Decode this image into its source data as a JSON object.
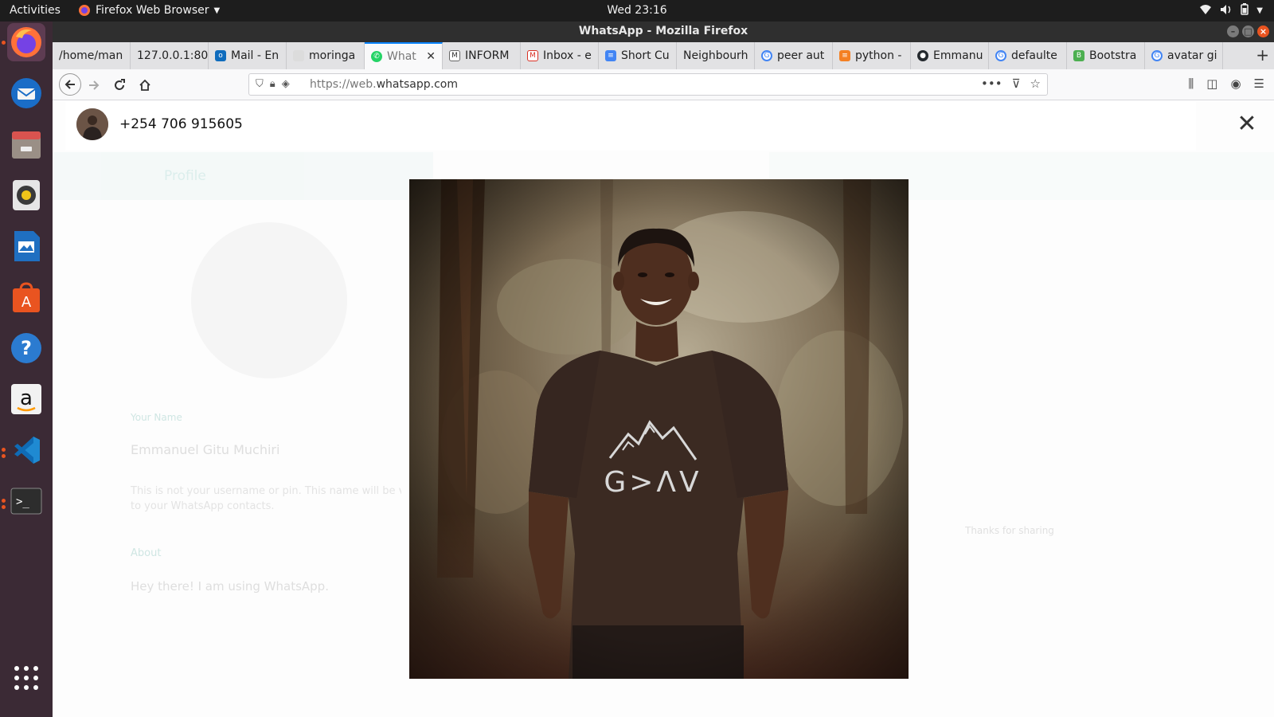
{
  "topbar": {
    "activities": "Activities",
    "app_name": "Firefox Web Browser",
    "clock": "Wed 23:16"
  },
  "dock": {
    "items": [
      "firefox-icon",
      "thunderbird-icon",
      "files-icon",
      "rhythmbox-icon",
      "writer-icon",
      "software-icon",
      "help-icon",
      "amazon-icon",
      "vscode-icon",
      "terminal-icon",
      "show-apps-icon"
    ]
  },
  "window": {
    "title": "WhatsApp - Mozilla Firefox"
  },
  "tabs": [
    {
      "label": "/home/man",
      "icon": "none"
    },
    {
      "label": "127.0.0.1:80",
      "icon": "none"
    },
    {
      "label": "Mail - En",
      "icon": "outlook-icon"
    },
    {
      "label": "moringa",
      "icon": "none"
    },
    {
      "label": "What",
      "icon": "whatsapp-icon",
      "active": true
    },
    {
      "label": "INFORM",
      "icon": "doc-icon"
    },
    {
      "label": "Inbox - e",
      "icon": "gmail-icon"
    },
    {
      "label": "Short Cu",
      "icon": "docs-icon"
    },
    {
      "label": "Neighbourh",
      "icon": "none"
    },
    {
      "label": "peer aut",
      "icon": "google-icon"
    },
    {
      "label": "python -",
      "icon": "stackoverflow-icon"
    },
    {
      "label": "Emmanu",
      "icon": "github-icon"
    },
    {
      "label": "defaulte",
      "icon": "google-icon"
    },
    {
      "label": "Bootstra",
      "icon": "bootstrap-icon"
    },
    {
      "label": "avatar gi",
      "icon": "google-icon"
    }
  ],
  "navbar": {
    "url_prefix": "https://web.",
    "url_domain": "whatsapp.com"
  },
  "viewer": {
    "contact": "+254 706 915605",
    "close_glyph": "✕"
  },
  "background_profile": {
    "header": "Profile",
    "name_label": "Your Name",
    "name": "Emmanuel Gitu Muchiri",
    "name_hint": "This is not your username or pin. This name will be visible",
    "name_hint2": "to your WhatsApp contacts.",
    "about_label": "About",
    "about": "Hey there! I am using WhatsApp.",
    "chat_snippet": "Thanks for sharing"
  },
  "colors": {
    "accent": "#0a84ff",
    "ubuntu_orange": "#e95420",
    "whatsapp_green": "#25d366"
  }
}
